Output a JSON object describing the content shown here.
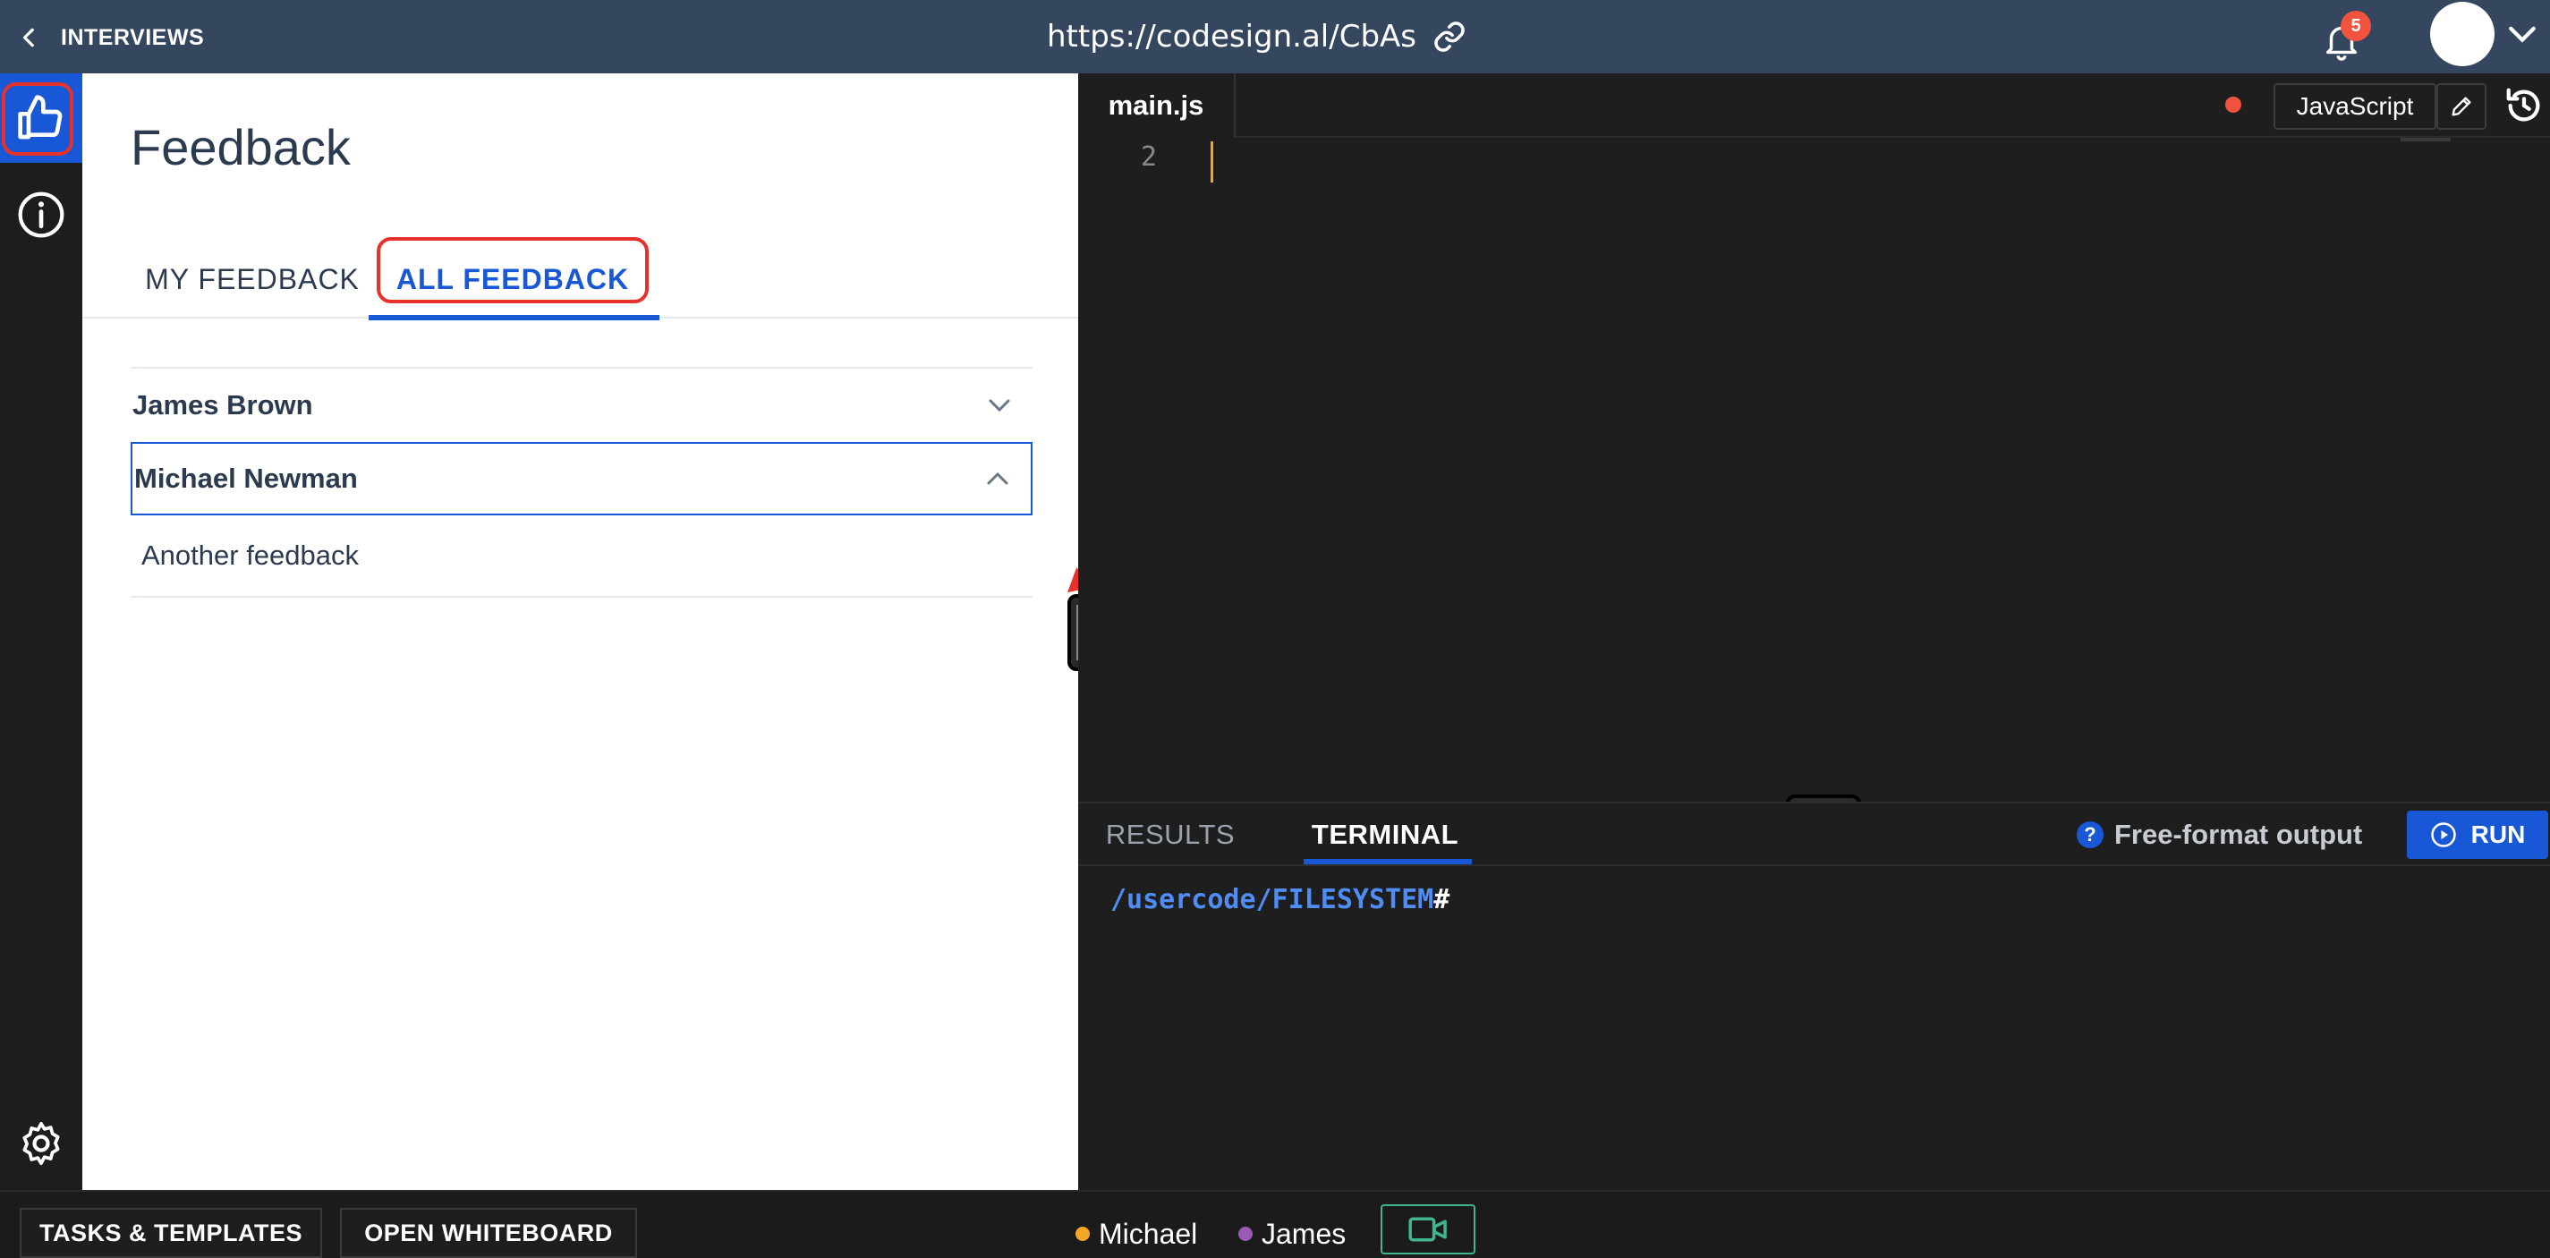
{
  "header": {
    "back_label": "INTERVIEWS",
    "url": "https://codesign.al/CbAs",
    "notification_count": "5"
  },
  "rail": {
    "items": [
      {
        "icon": "thumbs-up-icon",
        "active": true
      },
      {
        "icon": "info-icon",
        "active": false
      },
      {
        "icon": "gear-icon",
        "active": false
      }
    ]
  },
  "feedback": {
    "title": "Feedback",
    "tabs": [
      {
        "label": "MY FEEDBACK",
        "active": false
      },
      {
        "label": "ALL FEEDBACK",
        "active": true
      }
    ],
    "items": [
      {
        "name": "James Brown",
        "expanded": false
      },
      {
        "name": "Michael Newman",
        "expanded": true,
        "body": "Another feedback"
      }
    ]
  },
  "editor": {
    "file_tab": "main.js",
    "language": "JavaScript",
    "line_numbers": [
      "2"
    ],
    "unsaved_color": "#f0543f"
  },
  "output": {
    "tabs": [
      {
        "label": "RESULTS",
        "active": false
      },
      {
        "label": "TERMINAL",
        "active": true
      }
    ],
    "help_label": "Free-format output",
    "run_label": "RUN",
    "prompt_path": "/usercode/FILESYSTEM",
    "prompt_symbol": "#"
  },
  "footer": {
    "tasks_label": "TASKS & TEMPLATES",
    "whiteboard_label": "OPEN WHITEBOARD",
    "participants": [
      {
        "name": "Michael",
        "color": "#f5a623"
      },
      {
        "name": "James",
        "color": "#9b59b6"
      }
    ]
  },
  "colors": {
    "accent": "#1858d6",
    "topbar": "#35475f",
    "annotation": "#e8312b"
  }
}
